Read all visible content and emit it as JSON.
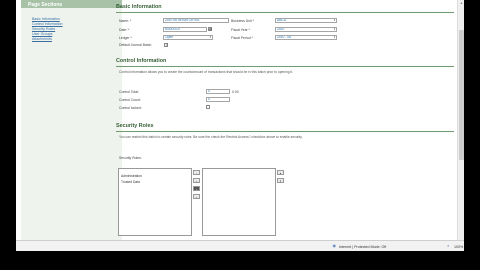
{
  "sidebar": {
    "title": "Page Sections",
    "links": [
      "Basic Information",
      "Control Information",
      "Security Roles",
      "User Groups",
      "Attachments"
    ]
  },
  "basic": {
    "title": "Basic Information",
    "name_label": "Name: *",
    "name_value": "2010 06 05 BATCH 001",
    "date_label": "Date: *",
    "date_value": "6/30/2010",
    "ledger_label": "Ledger *",
    "ledger_value": "Open",
    "default_label": "Default Journal Batch",
    "business_unit_label": "Business Unit *",
    "business_unit_value": "ABCU",
    "fiscal_year_label": "Fiscal Year *",
    "fiscal_year_value": "2010",
    "fiscal_period_label": "Fiscal Period *",
    "fiscal_period_value": "2010 - 06"
  },
  "control": {
    "title": "Control Information",
    "description": "Control information allows you to create the count/amount of transactions that should be in this batch prior to opening it.",
    "total_label": "Control Total:",
    "total_value": "0",
    "total_unit": "0.00",
    "count_label": "Control Count:",
    "count_value": "0",
    "locked_label": "Control locked:"
  },
  "security": {
    "title": "Security Roles",
    "description": "You can restrict this batch to certain security roles. Be sure the check the Restrict Access? checkbox above to enable security.",
    "roles_label": "Security Roles:",
    "available_roles": [
      "Administration",
      "Trusted Data"
    ]
  },
  "status": {
    "zone": "Internet | Protected Mode: Off",
    "zoom": "100%"
  },
  "icons": {
    "calendar": "calendar-icon",
    "globe": "globe-icon",
    "add": "add-icon",
    "remove": "remove-icon"
  }
}
